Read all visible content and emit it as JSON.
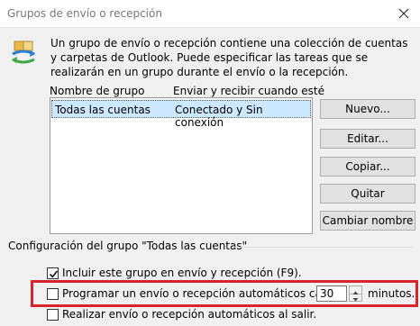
{
  "window": {
    "title": "Grupos de envío o recepción",
    "icon": "send-receive-icon",
    "close_icon": "close-icon"
  },
  "intro_text": "Un grupo de envío o recepción contiene una colección de cuentas y carpetas de Outlook. Puede especificar las tareas que se realizarán en un grupo durante el envío o la recepción.",
  "groups_table": {
    "columns": [
      "Nombre de grupo",
      "Enviar y recibir cuando esté"
    ],
    "rows": [
      {
        "name": "Todas las cuentas",
        "status": "Conectado y Sin conexión",
        "selected": true
      }
    ]
  },
  "buttons": {
    "new": "Nuevo...",
    "edit": "Editar...",
    "copy": "Copiar...",
    "remove": "Quitar",
    "rename": "Cambiar nombre"
  },
  "group_settings": {
    "label": "Configuración del grupo \"Todas las cuentas\"",
    "include": {
      "label": "Incluir este grupo en envío y recepción (F9).",
      "checked": true
    },
    "schedule": {
      "label": "Programar un envío o recepción automáticos cada",
      "checked": false,
      "minutes": "30",
      "unit": "minutos."
    },
    "on_exit": {
      "label": "Realizar envío o recepción automáticos al salir.",
      "checked": false
    }
  },
  "colors": {
    "selection": "#cce8ff",
    "highlight": "#d6262b"
  }
}
